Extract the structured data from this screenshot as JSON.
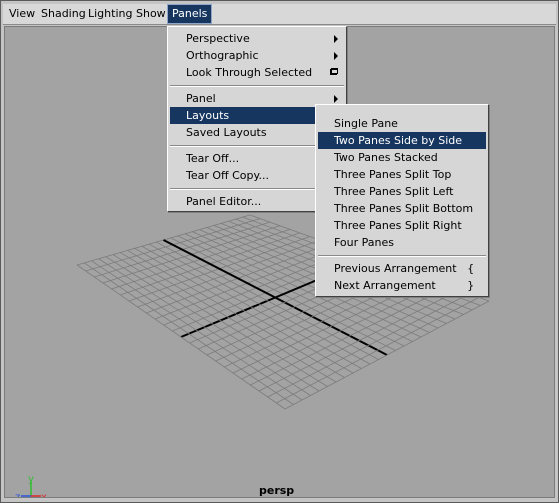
{
  "menubar": {
    "items": [
      "View",
      "Shading",
      "Lighting",
      "Show",
      "Panels"
    ],
    "active": "Panels"
  },
  "panels_menu": {
    "perspective": "Perspective",
    "orthographic": "Orthographic",
    "look_through_selected": "Look Through Selected",
    "panel": "Panel",
    "layouts": "Layouts",
    "saved_layouts": "Saved Layouts",
    "tear_off": "Tear Off...",
    "tear_off_copy": "Tear Off Copy...",
    "panel_editor": "Panel Editor..."
  },
  "layouts_menu": {
    "single_pane": "Single Pane",
    "two_panes_side_by_side": "Two Panes Side by Side",
    "two_panes_stacked": "Two Panes Stacked",
    "three_panes_split_top": "Three Panes Split Top",
    "three_panes_split_left": "Three Panes Split Left",
    "three_panes_split_bottom": "Three Panes Split Bottom",
    "three_panes_split_right": "Three Panes Split Right",
    "four_panes": "Four Panes",
    "previous_arrangement": "Previous Arrangement",
    "previous_hotkey": "{",
    "next_arrangement": "Next Arrangement",
    "next_hotkey": "}"
  },
  "viewport": {
    "camera": "persp",
    "axis_y": "y",
    "axis_z": "z",
    "axis_x": "x"
  },
  "colors": {
    "highlight": "#163660",
    "viewport_bg": "#a3a3a3",
    "grid_line": "#7c7c7c",
    "grid_axis": "#000000"
  }
}
